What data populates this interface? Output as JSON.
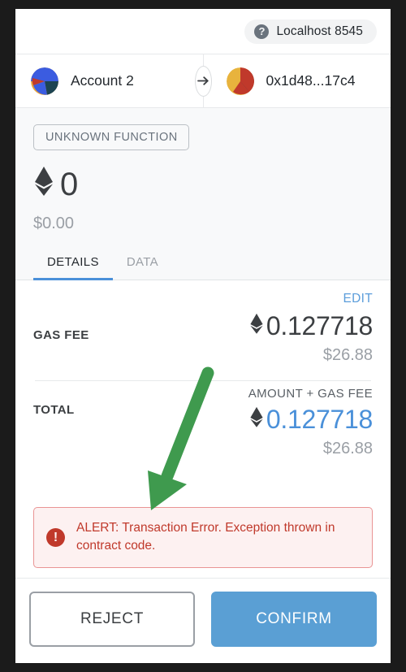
{
  "network": {
    "icon": "question-circle-icon",
    "name": "Localhost 8545"
  },
  "accounts": {
    "from_label": "Account 2",
    "to_label": "0x1d48...17c4",
    "direction_icon": "arrow-right-icon"
  },
  "summary": {
    "function_badge": "UNKNOWN FUNCTION",
    "amount": "0",
    "currency_icon": "ethereum-icon",
    "fiat": "$0.00"
  },
  "tabs": [
    {
      "label": "DETAILS",
      "active": true
    },
    {
      "label": "DATA",
      "active": false
    }
  ],
  "details": {
    "edit_label": "EDIT",
    "gas_fee": {
      "label": "GAS FEE",
      "crypto": "0.127718",
      "fiat": "$26.88"
    },
    "total": {
      "label": "TOTAL",
      "sub_label": "AMOUNT + GAS FEE",
      "crypto": "0.127718",
      "fiat": "$26.88"
    }
  },
  "alert": {
    "icon": "error-exclamation-icon",
    "message": "ALERT: Transaction Error. Exception thrown in contract code."
  },
  "footer": {
    "reject_label": "REJECT",
    "confirm_label": "CONFIRM"
  },
  "annotation": {
    "shape": "green-down-left-arrow"
  },
  "colors": {
    "accent_blue": "#4a90d9",
    "confirm_blue": "#5a9fd4",
    "alert_red": "#c0392b",
    "alert_bg": "#fdf1f1",
    "annotation_green": "#3f9a4e",
    "muted_gray": "#9a9fa5",
    "text_dark": "#3c3f42"
  }
}
